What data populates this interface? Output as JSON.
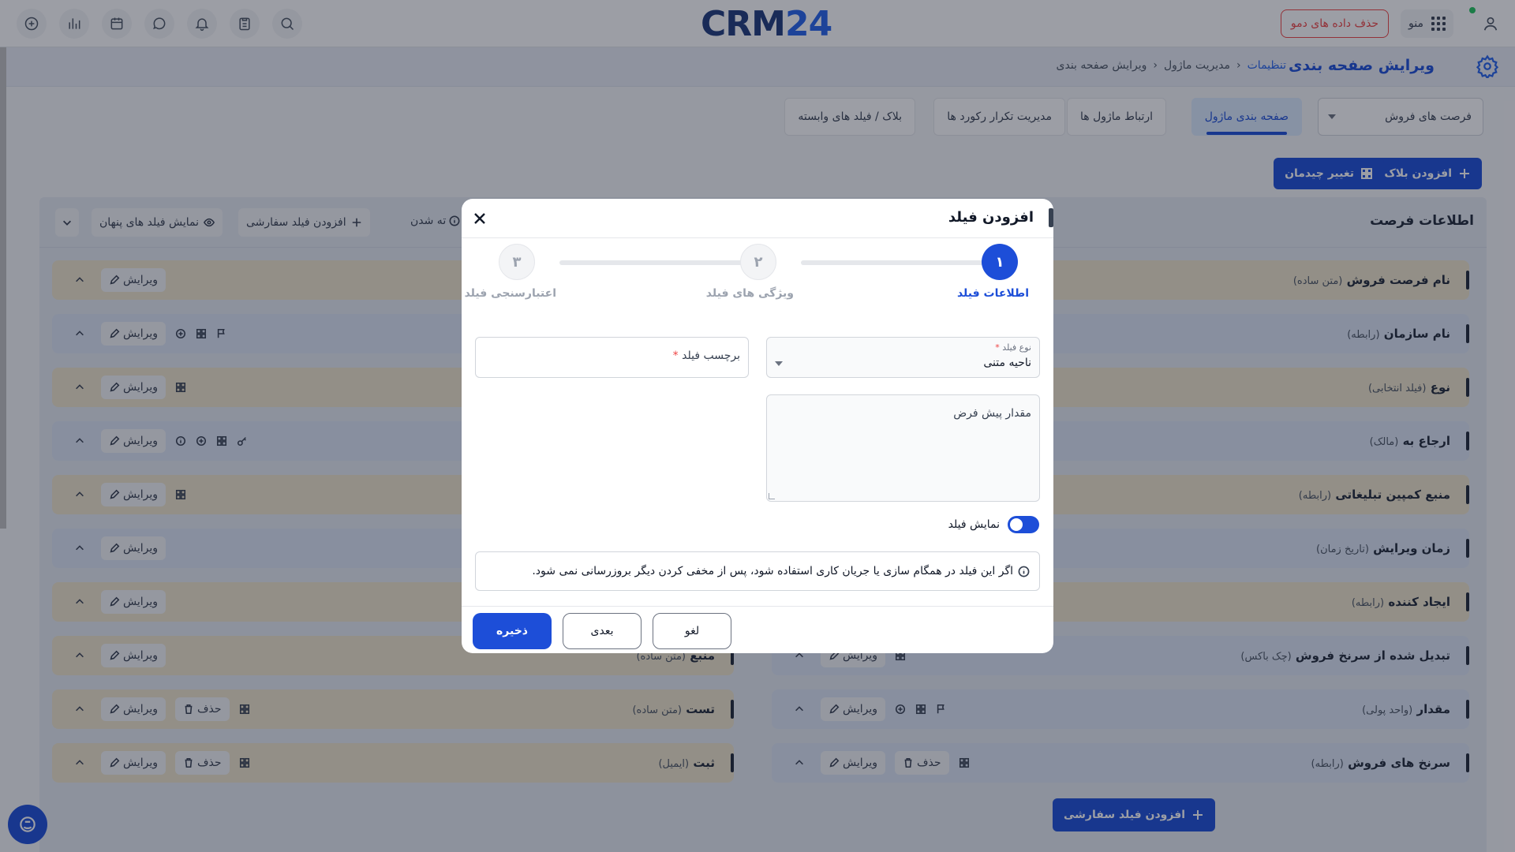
{
  "topbar": {
    "logo_main": "CRM",
    "logo_num": "24",
    "demo_label": "حذف داده های دمو",
    "menu_label": "منو"
  },
  "header": {
    "title": "ویرایش صفحه بندی",
    "breadcrumb": [
      "تنظیمات",
      "مدیریت ماژول",
      "ویرایش صفحه بندی"
    ]
  },
  "module_select": {
    "value": "فرصت های فروش"
  },
  "tabs": [
    {
      "label": "صفحه بندی ماژول",
      "active": true
    },
    {
      "label": "ارتباط ماژول ها"
    },
    {
      "label": "مدیریت تکرار رکورد ها"
    },
    {
      "label": "بلاک / فیلد های وابسته"
    }
  ],
  "actions": {
    "add_block": "افزودن بلاک",
    "change_layout": "تغییر چیدمان"
  },
  "panel": {
    "title": "اطلاعات فرصت",
    "show_hidden": "نمایش فیلد های پنهان",
    "add_custom": "افزودن فیلد سفارشی",
    "hint": "ته شدن"
  },
  "rows_right": [
    {
      "label": "نام فرصت فروش",
      "type": "(متن ساده)"
    },
    {
      "label": "نام سازمان",
      "type": "(رابطه)"
    },
    {
      "label": "نوع",
      "type": "(فیلد انتخابی)"
    },
    {
      "label": "ارجاع به",
      "type": "(مالک)"
    },
    {
      "label": "منبع کمپین تبلیغاتی",
      "type": "(رابطه)"
    },
    {
      "label": "زمان ویرایش",
      "type": "(تاریخ زمان)"
    },
    {
      "label": "ایجاد کننده",
      "type": "(رابطه)"
    },
    {
      "label": "تبدیل شده از سرنخ فروش",
      "type": "(چک باکس)"
    },
    {
      "label": "مقدار",
      "type": "(واحد پولی)"
    },
    {
      "label": "سرنخ های فروش",
      "type": "(رابطه)"
    }
  ],
  "rows_left": [
    {
      "label": "منبع",
      "type": "(متن ساده)"
    },
    {
      "label": "تست",
      "type": "(متن ساده)"
    },
    {
      "label": "ثبت",
      "type": "(ایمیل)"
    }
  ],
  "row_actions": {
    "edit": "ویرایش",
    "delete": "حذف"
  },
  "bottom_add": "افزودن فیلد سفارشی",
  "modal": {
    "title": "افزودن فیلد",
    "steps": [
      {
        "num": "۱",
        "label": "اطلاعات فیلد"
      },
      {
        "num": "۲",
        "label": "ویژگی های فیلد"
      },
      {
        "num": "۳",
        "label": "اعتبارسنجی فیلد"
      }
    ],
    "field_type_label": "نوع فیلد",
    "field_type_value": "ناحیه متنی",
    "field_label_placeholder": "برچسب فیلد",
    "default_value_placeholder": "مقدار پیش فرض",
    "show_field_label": "نمایش فیلد",
    "info_text": "اگر این فیلد در همگام سازی یا جریان کاری استفاده شود، پس از مخفی کردن دیگر بروزرسانی نمی شود.",
    "save": "ذخیره",
    "next": "بعدی",
    "cancel": "لغو"
  }
}
